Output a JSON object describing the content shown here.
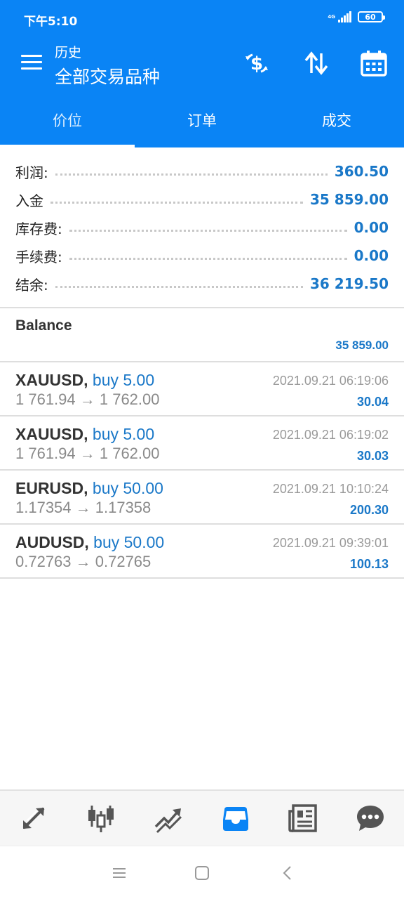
{
  "status_bar": {
    "time": "下午5:10",
    "network": "4G",
    "battery": "60"
  },
  "app_bar": {
    "subtitle": "历史",
    "title": "全部交易品种"
  },
  "tabs": [
    {
      "label": "价位",
      "active": true
    },
    {
      "label": "订单",
      "active": false
    },
    {
      "label": "成交",
      "active": false
    }
  ],
  "summary": {
    "profit": {
      "label": "利润:",
      "value": "360.50"
    },
    "deposit": {
      "label": "入金",
      "value": "35 859.00"
    },
    "swap": {
      "label": "库存费:",
      "value": "0.00"
    },
    "commission": {
      "label": "手续费:",
      "value": "0.00"
    },
    "balance": {
      "label": "结余:",
      "value": "36 219.50"
    }
  },
  "balance_entry": {
    "label": "Balance",
    "value": "35 859.00"
  },
  "deals": [
    {
      "symbol": "XAUUSD,",
      "type": "buy 5.00",
      "prices": "1 761.94 → 1 762.00",
      "time": "2021.09.21 06:19:06",
      "profit": "30.04"
    },
    {
      "symbol": "XAUUSD,",
      "type": "buy 5.00",
      "prices": "1 761.94 → 1 762.00",
      "time": "2021.09.21 06:19:02",
      "profit": "30.03"
    },
    {
      "symbol": "EURUSD,",
      "type": "buy 50.00",
      "prices": "1.17354 → 1.17358",
      "time": "2021.09.21 10:10:24",
      "profit": "200.30"
    },
    {
      "symbol": "AUDUSD,",
      "type": "buy 50.00",
      "prices": "0.72763 → 0.72765",
      "time": "2021.09.21 09:39:01",
      "profit": "100.13"
    }
  ],
  "bottom_nav": [
    {
      "icon": "quotes-arrows-icon",
      "active": false
    },
    {
      "icon": "candlestick-chart-icon",
      "active": false
    },
    {
      "icon": "trade-trend-icon",
      "active": false
    },
    {
      "icon": "history-inbox-icon",
      "active": true
    },
    {
      "icon": "news-icon",
      "active": false
    },
    {
      "icon": "chat-bubble-icon",
      "active": false
    }
  ],
  "colors": {
    "primary": "#0a84f5",
    "value_blue": "#1a78c8",
    "nav_icon": "#555555"
  }
}
